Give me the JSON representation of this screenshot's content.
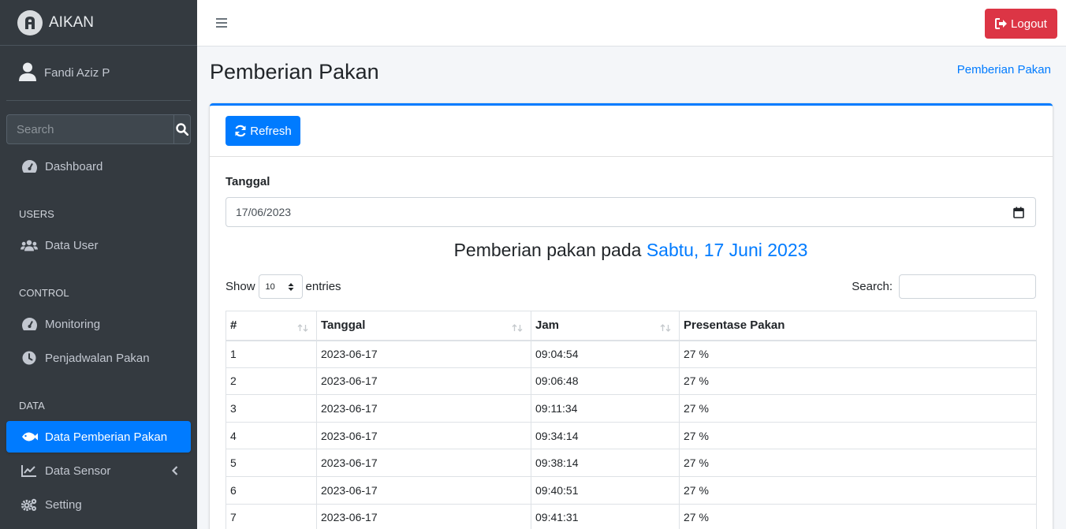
{
  "brand": {
    "name": "AIKAN"
  },
  "user": {
    "name": "Fandi Aziz P"
  },
  "sidebar": {
    "search_placeholder": "Search",
    "dashboard": "Dashboard",
    "users_header": "USERS",
    "data_user": "Data User",
    "control_header": "CONTROL",
    "monitoring": "Monitoring",
    "penjadwalan": "Penjadwalan Pakan",
    "data_header": "DATA",
    "data_pemberian": "Data Pemberian Pakan",
    "data_sensor": "Data Sensor",
    "setting": "Setting"
  },
  "navbar": {
    "logout": "Logout"
  },
  "page": {
    "title": "Pemberian Pakan",
    "breadcrumb": "Pemberian Pakan"
  },
  "card": {
    "refresh": "Refresh",
    "date_label": "Tanggal",
    "date_value": "17/06/2023",
    "heading_prefix": "Pemberian pakan pada ",
    "heading_date": "Sabtu, 17 Juni 2023",
    "show_label": "Show",
    "entries_value": "10",
    "entries_label": "entries",
    "search_label": "Search:"
  },
  "table": {
    "headers": [
      "#",
      "Tanggal",
      "Jam",
      "Presentase Pakan"
    ],
    "rows": [
      [
        "1",
        "2023-06-17",
        "09:04:54",
        "27 %"
      ],
      [
        "2",
        "2023-06-17",
        "09:06:48",
        "27 %"
      ],
      [
        "3",
        "2023-06-17",
        "09:11:34",
        "27 %"
      ],
      [
        "4",
        "2023-06-17",
        "09:34:14",
        "27 %"
      ],
      [
        "5",
        "2023-06-17",
        "09:38:14",
        "27 %"
      ],
      [
        "6",
        "2023-06-17",
        "09:40:51",
        "27 %"
      ],
      [
        "7",
        "2023-06-17",
        "09:41:31",
        "27 %"
      ]
    ]
  },
  "colors": {
    "primary": "#007bff",
    "danger": "#dc3545",
    "sidebar": "#343a40"
  }
}
